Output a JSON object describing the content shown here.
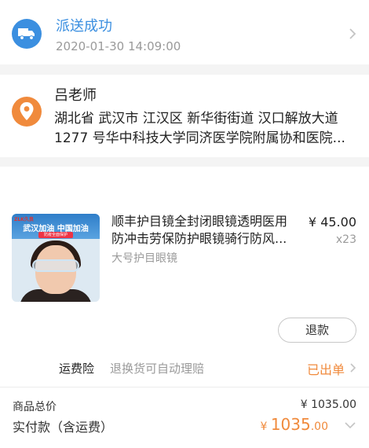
{
  "delivery": {
    "status": "派送成功",
    "time": "2020-01-30 14:09:00",
    "icon": "truck-icon"
  },
  "address": {
    "name": "吕老师",
    "line1": "湖北省 武汉市 江汉区 新华街街道 汉口解放大道",
    "line2": "1277 号华中科技大学同济医学院附属协和医院...",
    "icon": "location-pin-icon"
  },
  "product": {
    "title_line1": "顺丰护目镜全封闭眼镜透明医用",
    "title_line2": "防冲击劳保防护眼镜骑行防风...",
    "variant": "大号护目眼镜",
    "price": "¥ 45.00",
    "quantity": "x23",
    "thumb_slogan": "武汉加油  中国加油",
    "thumb_logo": "ZLK久良",
    "thumb_tag": "防疫全面保护"
  },
  "actions": {
    "refund": "退款"
  },
  "insurance": {
    "label": "运费险",
    "desc": "退换货可自动理赔",
    "status": "已出单"
  },
  "summary": {
    "goods_total_label": "商品总价",
    "goods_total_value": "¥ 1035.00",
    "paid_label": "实付款（含运费）",
    "paid_symbol": "¥ ",
    "paid_int": "1035",
    "paid_dec": ".00"
  },
  "colors": {
    "blue": "#3b8fe0",
    "orange": "#f08a3c",
    "gray_text": "#9a9a9a"
  }
}
